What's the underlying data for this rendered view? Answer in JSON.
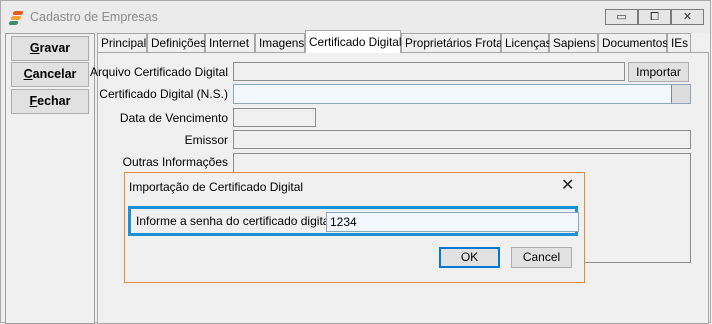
{
  "window": {
    "title": "Cadastro de Empresas",
    "controls": {
      "minimize": "▭",
      "restore": "⧠",
      "close": "✕"
    },
    "brand_colors": [
      "#e65c24",
      "#f4a236",
      "#3d8c6e"
    ]
  },
  "sidebar": {
    "buttons": [
      {
        "accel": "G",
        "rest": "ravar"
      },
      {
        "accel": "C",
        "rest": "ancelar"
      },
      {
        "accel": "F",
        "rest": "echar"
      }
    ]
  },
  "tabs": [
    {
      "label": "Principal"
    },
    {
      "label": "Definições"
    },
    {
      "label": "Internet"
    },
    {
      "label": "Imagens"
    },
    {
      "label": "Certificado Digital",
      "active": true
    },
    {
      "label": "Proprietários Frota"
    },
    {
      "label": "Licenças"
    },
    {
      "label": "Sapiens"
    },
    {
      "label": "Documentos"
    },
    {
      "label": "IEs"
    }
  ],
  "form": {
    "arquivo_label": "Arquivo Certificado Digital",
    "arquivo_value": "",
    "importar_label": "Importar",
    "ns_label": "Certificado Digital (N.S.)",
    "ns_value": "",
    "vencimento_label": "Data de Vencimento",
    "vencimento_value": "",
    "emissor_label": "Emissor",
    "emissor_value": "",
    "outras_label": "Outras Informações",
    "outras_value": ""
  },
  "dialog": {
    "title": "Importação de Certificado Digital",
    "prompt": "Informe a senha do certificado digital:",
    "password_value": "1234",
    "ok_label": "OK",
    "cancel_label": "Cancel",
    "close_glyph": "✕",
    "accent_color": "#1e90d6",
    "frame_color": "#e68a38"
  }
}
